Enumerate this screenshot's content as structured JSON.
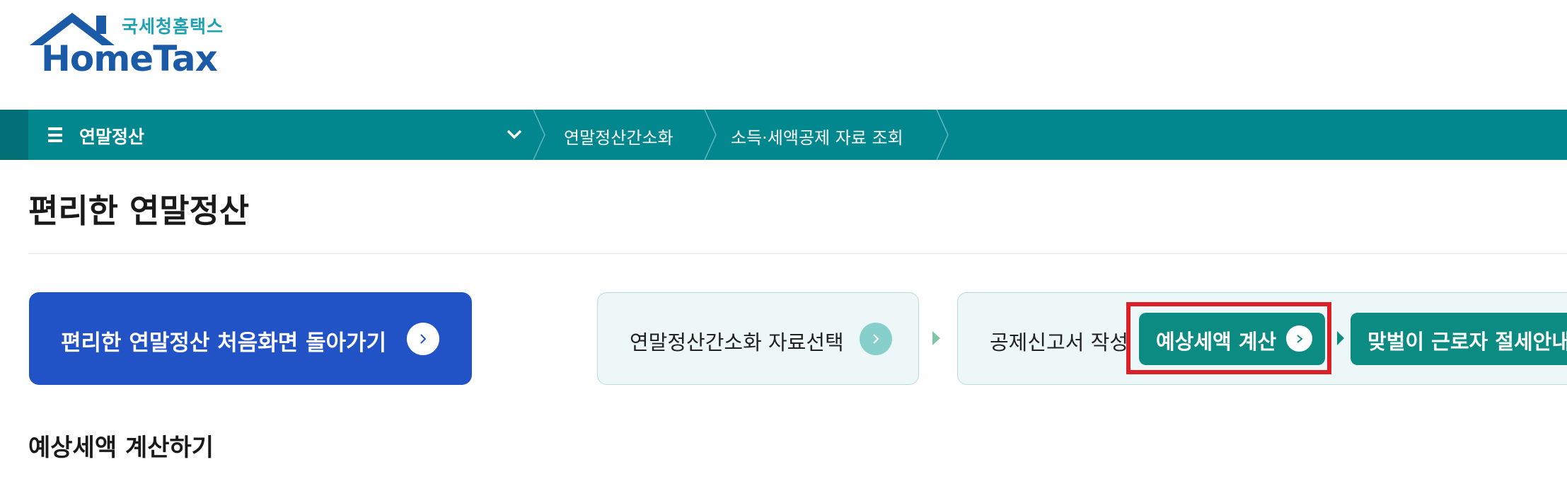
{
  "logo": {
    "subtitle": "국세청홈택스",
    "title": "HomeTax"
  },
  "nav": {
    "menu_label": "연말정산",
    "breadcrumbs": [
      {
        "label": "연말정산간소화"
      },
      {
        "label": "소득·세액공제 자료 조회"
      }
    ]
  },
  "page": {
    "title": "편리한 연말정산",
    "section_title": "예상세액 계산하기"
  },
  "back_button": {
    "label": "편리한 연말정산 처음화면 돌아가기"
  },
  "steps": [
    {
      "label": "연말정산간소화 자료선택"
    },
    {
      "label": "공제신고서 작성"
    },
    {
      "label": "예상세액 계산"
    },
    {
      "label": "맞벌이 근로자 절세안내"
    }
  ],
  "colors": {
    "nav_bg": "#03878f",
    "back_button_bg": "#2153c6",
    "step_button_bg": "#0c8b83",
    "highlight": "#dd1f27",
    "logo_blue": "#1b5aa6",
    "logo_cyan": "#1ea1b1"
  }
}
